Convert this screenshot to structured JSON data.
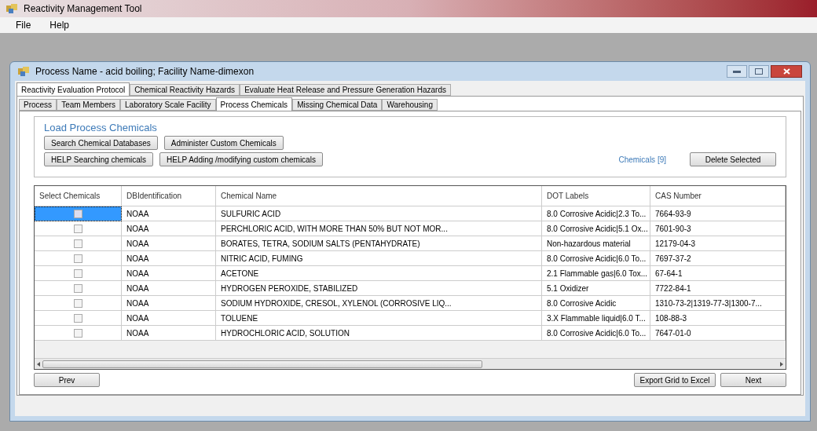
{
  "app": {
    "title": "Reactivity Management Tool"
  },
  "menu": [
    "File",
    "Help"
  ],
  "window": {
    "title": "Process Name - acid boiling; Facility Name-dimexon"
  },
  "tabs": [
    {
      "label": "Reactivity Evaluation Protocol",
      "selected": true
    },
    {
      "label": "Chemical Reactivity Hazards",
      "selected": false
    },
    {
      "label": "Evaluate Heat Release and Pressure Generation Hazards",
      "selected": false
    }
  ],
  "subtabs": [
    {
      "label": "Process",
      "selected": false
    },
    {
      "label": "Team Members",
      "selected": false
    },
    {
      "label": "Laboratory Scale Facility",
      "selected": false
    },
    {
      "label": "Process Chemicals",
      "selected": true
    },
    {
      "label": "Missing Chemical Data",
      "selected": false
    },
    {
      "label": "Warehousing",
      "selected": false
    }
  ],
  "panel": {
    "heading": "Load Process Chemicals",
    "buttons_row1": [
      "Search Chemical Databases",
      "Administer Custom Chemicals"
    ],
    "buttons_row2": [
      "HELP Searching chemicals",
      "HELP Adding /modifying custom chemicals"
    ],
    "count": "Chemicals [9]",
    "delete_button": "Delete Selected"
  },
  "table": {
    "columns": [
      "Select Chemicals",
      "DBIdentification",
      "Chemical Name",
      "DOT Labels",
      "CAS Number"
    ],
    "rows": [
      {
        "selected": true,
        "checked": false,
        "db": "NOAA",
        "name": "SULFURIC ACID",
        "dot": "8.0  Corrosive Acidic|2.3  To...",
        "cas": "7664-93-9"
      },
      {
        "selected": false,
        "checked": false,
        "db": "NOAA",
        "name": "PERCHLORIC ACID, WITH MORE THAN 50% BUT NOT MOR...",
        "dot": "8.0  Corrosive Acidic|5.1  Ox...",
        "cas": "7601-90-3"
      },
      {
        "selected": false,
        "checked": false,
        "db": "NOAA",
        "name": "BORATES, TETRA, SODIUM SALTS (PENTAHYDRATE)",
        "dot": "Non-hazardous material",
        "cas": "12179-04-3"
      },
      {
        "selected": false,
        "checked": false,
        "db": "NOAA",
        "name": "NITRIC ACID, FUMING",
        "dot": "8.0  Corrosive Acidic|6.0  To...",
        "cas": "7697-37-2"
      },
      {
        "selected": false,
        "checked": false,
        "db": "NOAA",
        "name": "ACETONE",
        "dot": "2.1  Flammable gas|6.0  Tox...",
        "cas": "67-64-1"
      },
      {
        "selected": false,
        "checked": false,
        "db": "NOAA",
        "name": "HYDROGEN PEROXIDE, STABILIZED",
        "dot": "5.1  Oxidizer",
        "cas": "7722-84-1"
      },
      {
        "selected": false,
        "checked": false,
        "db": "NOAA",
        "name": "SODIUM HYDROXIDE, CRESOL, XYLENOL (CORROSIVE LIQ...",
        "dot": "8.0  Corrosive Acidic",
        "cas": "1310-73-2|1319-77-3|1300-7..."
      },
      {
        "selected": false,
        "checked": false,
        "db": "NOAA",
        "name": "TOLUENE",
        "dot": "3.X  Flammable liquid|6.0  T...",
        "cas": "108-88-3"
      },
      {
        "selected": false,
        "checked": false,
        "db": "NOAA",
        "name": "HYDROCHLORIC ACID, SOLUTION",
        "dot": "8.0  Corrosive Acidic|6.0  To...",
        "cas": "7647-01-0"
      }
    ]
  },
  "footer": {
    "prev": "Prev",
    "export": "Export Grid to Excel",
    "next": "Next"
  }
}
